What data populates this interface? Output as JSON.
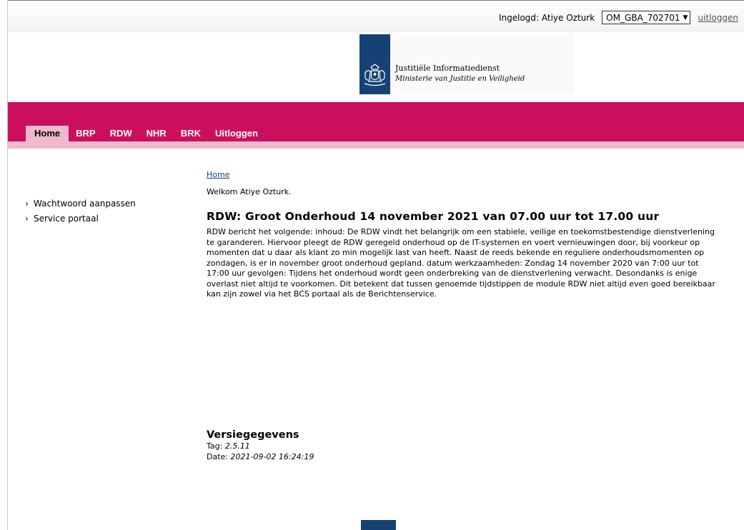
{
  "header": {
    "logged_in_label": "Ingelogd: Atiye Ozturk",
    "account_selected": "OM_GBA_702701",
    "logout_label": "uitloggen"
  },
  "logo": {
    "line1": "Justitiële Informatiedienst",
    "line2": "Ministerie van Justitie en Veiligheid",
    "ribbon_color": "#154273"
  },
  "nav": {
    "items": [
      "Home",
      "BRP",
      "RDW",
      "NHR",
      "BRK",
      "Uitloggen"
    ],
    "active": "Home",
    "band_color": "#cc0f5c"
  },
  "sidebar": {
    "items": [
      "Wachtwoord aanpassen",
      "Service portaal"
    ]
  },
  "main": {
    "breadcrumb": "Home",
    "welcome": "Welkom Atiye Ozturk.",
    "news_title": "RDW: Groot Onderhoud 14 november 2021 van 07.00 uur tot 17.00 uur",
    "news_body": "RDW bericht het volgende: inhoud: De RDW vindt het belangrijk om een stabiele, veilige en toekomstbestendige dienstverlening te garanderen. Hiervoor pleegt de RDW geregeld onderhoud op de IT-systemen en voert vernieuwingen door, bij voorkeur op momenten dat u daar als klant zo min mogelijk last van heeft. Naast de reeds bekende en reguliere onderhoudsmomenten op zondagen, is er in november groot onderhoud gepland. datum werkzaamheden: Zondag 14 november 2020 van 7:00 uur tot 17:00 uur gevolgen: Tijdens het onderhoud wordt geen onderbreking van de dienstverlening verwacht. Desondanks is enige overlast niet altijd te voorkomen. Dit betekent dat tussen genoemde tijdstippen de module RDW niet altijd even goed bereikbaar kan zijn zowel via het BCS portaal als de Berichtenservice."
  },
  "version": {
    "title": "Versiegegevens",
    "tag_label": "Tag:",
    "tag_value": "2.5.11",
    "date_label": "Date:",
    "date_value": "2021-09-02 16:24:19"
  }
}
